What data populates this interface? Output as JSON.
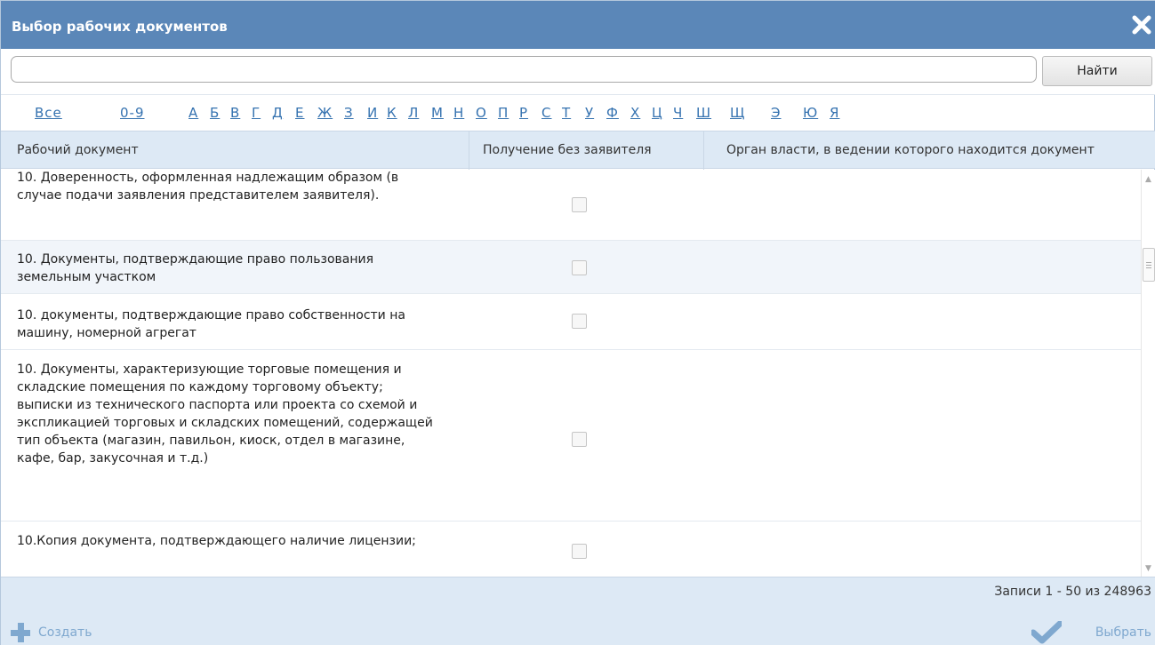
{
  "dialog": {
    "title": "Выбор рабочих документов",
    "close_icon": "close-icon"
  },
  "search": {
    "value": "",
    "placeholder": "",
    "button_label": "Найти"
  },
  "alphabet": [
    "Все",
    "0-9",
    "А",
    "Б",
    "В",
    "Г",
    "Д",
    "Е",
    "Ж",
    "З",
    "И",
    "К",
    "Л",
    "М",
    "Н",
    "О",
    "П",
    "Р",
    "С",
    "Т",
    "У",
    "Ф",
    "Х",
    "Ц",
    "Ч",
    "Ш",
    "Щ",
    "Э",
    "Ю",
    "Я"
  ],
  "table": {
    "columns": [
      "Рабочий документ",
      "Получение без заявителя",
      "Орган власти, в ведении которого находится документ"
    ],
    "rows": [
      {
        "document": "10. Доверенность, оформленная надлежащим образом (в случае подачи заявления представителем заявителя).",
        "without_applicant": false,
        "authority": ""
      },
      {
        "document": "10. Документы, подтверждающие право пользования земельным участком",
        "without_applicant": false,
        "authority": ""
      },
      {
        "document": "10. документы, подтверждающие право собственности на машину, номерной агрегат",
        "without_applicant": false,
        "authority": ""
      },
      {
        "document": "10. Документы, характеризующие торговые помещения и складские помещения по каждому торговому объекту; выписки из технического паспорта или проекта со схемой и экспликацией торговых и складских помещений, содержащей тип объекта (магазин, павильон, киоск, отдел в магазине, кафе, бар, закусочная и т.д.)",
        "without_applicant": false,
        "authority": ""
      },
      {
        "document": "10.Копия документа, подтверждающего наличие лицензии;",
        "without_applicant": false,
        "authority": ""
      }
    ]
  },
  "footer": {
    "records": "Записи 1 - 50 из 248963",
    "create_label": "Создать",
    "select_label": "Выбрать"
  },
  "colors": {
    "titlebar": "#5b87b8",
    "header_bg": "#dde9f5",
    "link": "#3572b0",
    "action": "#7fa8cf"
  }
}
